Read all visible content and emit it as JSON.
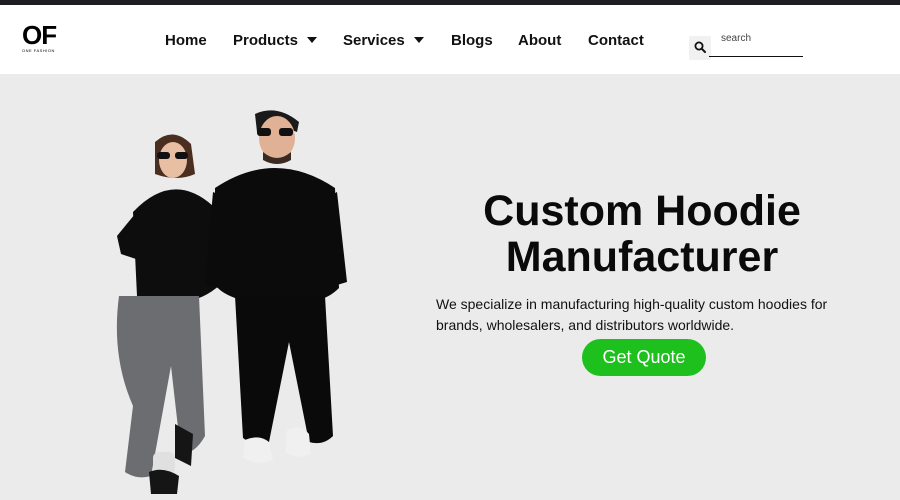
{
  "brand": {
    "logo_mark": "OF",
    "logo_sub": "ONE FASHION"
  },
  "nav": {
    "items": [
      {
        "label": "Home",
        "dropdown": false
      },
      {
        "label": "Products",
        "dropdown": true
      },
      {
        "label": "Services",
        "dropdown": true
      },
      {
        "label": "Blogs",
        "dropdown": false
      },
      {
        "label": "About",
        "dropdown": false
      },
      {
        "label": "Contact",
        "dropdown": false
      }
    ]
  },
  "search": {
    "placeholder": "search",
    "icon": "search-icon"
  },
  "hero": {
    "title_line1": "Custom Hoodie",
    "title_line2": "Manufacturer",
    "description": "We specialize in manufacturing high-quality custom hoodies for brands, wholesalers, and distributors worldwide.",
    "cta_label": "Get Quote"
  },
  "colors": {
    "topbar": "#1e1e22",
    "header_bg": "#ffffff",
    "hero_bg": "#ebebeb",
    "cta": "#1ec01e",
    "text": "#111111"
  }
}
